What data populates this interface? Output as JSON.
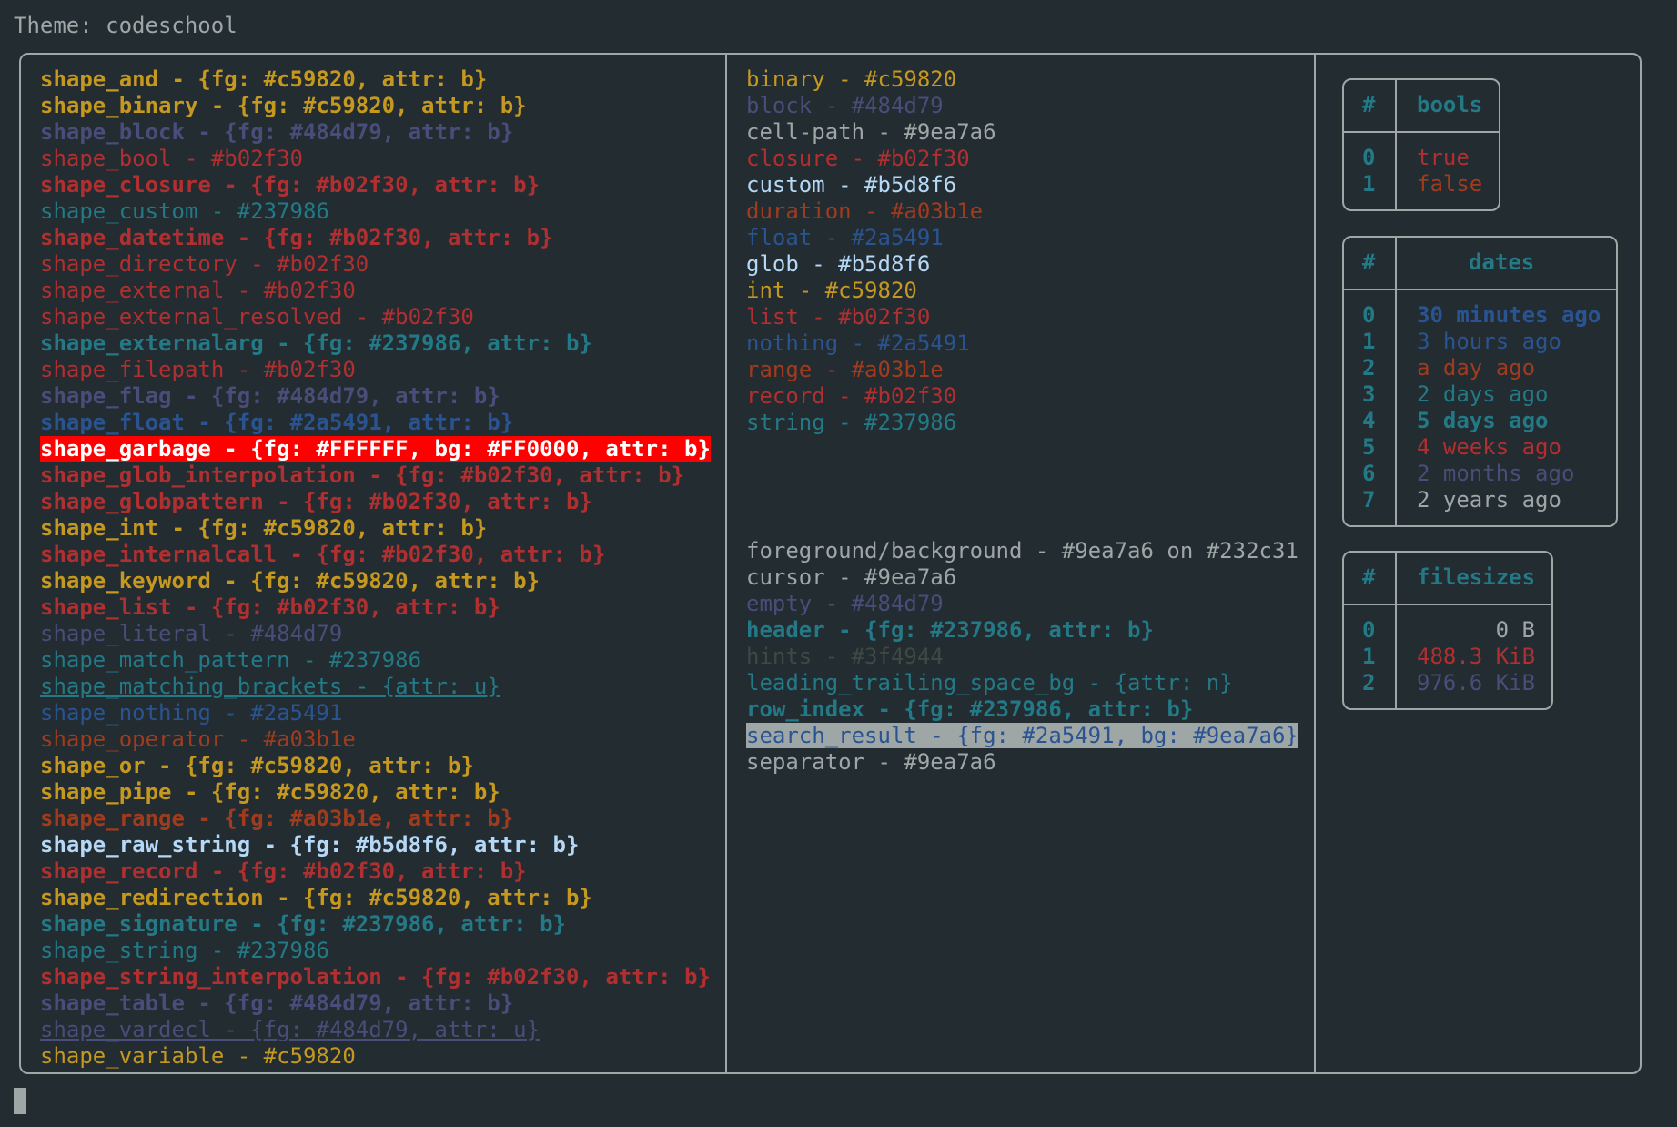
{
  "header": {
    "title": "Theme: codeschool"
  },
  "colors": {
    "background": "#232c31",
    "foreground": "#9ea7a6",
    "yellow": "#c59820",
    "purple": "#484d79",
    "red": "#b02f30",
    "teal": "#237986",
    "blue": "#2a5491",
    "orange": "#a03b1e",
    "light": "#b5d8f6",
    "hint": "#3f4944"
  },
  "shapes": [
    {
      "text": "shape_and - {fg: #c59820, attr: b}",
      "fg": "#c59820",
      "bold": true
    },
    {
      "text": "shape_binary - {fg: #c59820, attr: b}",
      "fg": "#c59820",
      "bold": true
    },
    {
      "text": "shape_block - {fg: #484d79, attr: b}",
      "fg": "#484d79",
      "bold": true
    },
    {
      "text": "shape_bool - #b02f30",
      "fg": "#b02f30"
    },
    {
      "text": "shape_closure - {fg: #b02f30, attr: b}",
      "fg": "#b02f30",
      "bold": true
    },
    {
      "text": "shape_custom - #237986",
      "fg": "#237986"
    },
    {
      "text": "shape_datetime - {fg: #b02f30, attr: b}",
      "fg": "#b02f30",
      "bold": true
    },
    {
      "text": "shape_directory - #b02f30",
      "fg": "#b02f30"
    },
    {
      "text": "shape_external - #b02f30",
      "fg": "#b02f30"
    },
    {
      "text": "shape_external_resolved - #b02f30",
      "fg": "#b02f30"
    },
    {
      "text": "shape_externalarg - {fg: #237986, attr: b}",
      "fg": "#237986",
      "bold": true
    },
    {
      "text": "shape_filepath - #b02f30",
      "fg": "#b02f30"
    },
    {
      "text": "shape_flag - {fg: #484d79, attr: b}",
      "fg": "#484d79",
      "bold": true
    },
    {
      "text": "shape_float - {fg: #2a5491, attr: b}",
      "fg": "#2a5491",
      "bold": true
    },
    {
      "text": "shape_garbage - {fg: #FFFFFF, bg: #FF0000, attr: b}",
      "fg": "#FFFFFF",
      "bg": "#FF0000",
      "bold": true
    },
    {
      "text": "shape_glob_interpolation - {fg: #b02f30, attr: b}",
      "fg": "#b02f30",
      "bold": true
    },
    {
      "text": "shape_globpattern - {fg: #b02f30, attr: b}",
      "fg": "#b02f30",
      "bold": true
    },
    {
      "text": "shape_int - {fg: #c59820, attr: b}",
      "fg": "#c59820",
      "bold": true
    },
    {
      "text": "shape_internalcall - {fg: #b02f30, attr: b}",
      "fg": "#b02f30",
      "bold": true
    },
    {
      "text": "shape_keyword - {fg: #c59820, attr: b}",
      "fg": "#c59820",
      "bold": true
    },
    {
      "text": "shape_list - {fg: #b02f30, attr: b}",
      "fg": "#b02f30",
      "bold": true
    },
    {
      "text": "shape_literal - #484d79",
      "fg": "#484d79"
    },
    {
      "text": "shape_match_pattern - #237986",
      "fg": "#237986"
    },
    {
      "text": "shape_matching_brackets - {attr: u}",
      "fg": "#237986",
      "underline": true
    },
    {
      "text": "shape_nothing - #2a5491",
      "fg": "#2a5491"
    },
    {
      "text": "shape_operator - #a03b1e",
      "fg": "#a03b1e"
    },
    {
      "text": "shape_or - {fg: #c59820, attr: b}",
      "fg": "#c59820",
      "bold": true
    },
    {
      "text": "shape_pipe - {fg: #c59820, attr: b}",
      "fg": "#c59820",
      "bold": true
    },
    {
      "text": "shape_range - {fg: #a03b1e, attr: b}",
      "fg": "#a03b1e",
      "bold": true
    },
    {
      "text": "shape_raw_string - {fg: #b5d8f6, attr: b}",
      "fg": "#b5d8f6",
      "bold": true
    },
    {
      "text": "shape_record - {fg: #b02f30, attr: b}",
      "fg": "#b02f30",
      "bold": true
    },
    {
      "text": "shape_redirection - {fg: #c59820, attr: b}",
      "fg": "#c59820",
      "bold": true
    },
    {
      "text": "shape_signature - {fg: #237986, attr: b}",
      "fg": "#237986",
      "bold": true
    },
    {
      "text": "shape_string - #237986",
      "fg": "#237986"
    },
    {
      "text": "shape_string_interpolation - {fg: #b02f30, attr: b}",
      "fg": "#b02f30",
      "bold": true
    },
    {
      "text": "shape_table - {fg: #484d79, attr: b}",
      "fg": "#484d79",
      "bold": true
    },
    {
      "text": "shape_vardecl - {fg: #484d79, attr: u}",
      "fg": "#484d79",
      "underline": true
    },
    {
      "text": "shape_variable - #c59820",
      "fg": "#c59820"
    }
  ],
  "types": [
    {
      "text": "binary - #c59820",
      "fg": "#c59820"
    },
    {
      "text": "block - #484d79",
      "fg": "#484d79"
    },
    {
      "text": "cell-path - #9ea7a6",
      "fg": "#9ea7a6"
    },
    {
      "text": "closure - #b02f30",
      "fg": "#b02f30"
    },
    {
      "text": "custom - #b5d8f6",
      "fg": "#b5d8f6"
    },
    {
      "text": "duration - #a03b1e",
      "fg": "#a03b1e"
    },
    {
      "text": "float - #2a5491",
      "fg": "#2a5491"
    },
    {
      "text": "glob - #b5d8f6",
      "fg": "#b5d8f6"
    },
    {
      "text": "int - #c59820",
      "fg": "#c59820"
    },
    {
      "text": "list - #b02f30",
      "fg": "#b02f30"
    },
    {
      "text": "nothing - #2a5491",
      "fg": "#2a5491"
    },
    {
      "text": "range - #a03b1e",
      "fg": "#a03b1e"
    },
    {
      "text": "record - #b02f30",
      "fg": "#b02f30"
    },
    {
      "text": "string - #237986",
      "fg": "#237986"
    }
  ],
  "ui": [
    {
      "text": "foreground/background - #9ea7a6 on #232c31",
      "fg": "#9ea7a6"
    },
    {
      "text": "cursor - #9ea7a6",
      "fg": "#9ea7a6"
    },
    {
      "text": "empty - #484d79",
      "fg": "#484d79"
    },
    {
      "text": "header - {fg: #237986, attr: b}",
      "fg": "#237986",
      "bold": true
    },
    {
      "text": "hints - #3f4944",
      "fg": "#3f4944"
    },
    {
      "text": "leading_trailing_space_bg - {attr: n}",
      "fg": "#237986"
    },
    {
      "text": "row_index - {fg: #237986, attr: b}",
      "fg": "#237986",
      "bold": true
    },
    {
      "text": "search_result - {fg: #2a5491, bg: #9ea7a6}",
      "fg": "#2a5491",
      "bg": "#9ea7a6"
    },
    {
      "text": "separator - #9ea7a6",
      "fg": "#9ea7a6"
    }
  ],
  "tables": {
    "bools": {
      "index_header": "#",
      "header": "bools",
      "rows": [
        {
          "index": "0",
          "value": "true",
          "fg": "#b02f30"
        },
        {
          "index": "1",
          "value": "false",
          "fg": "#a03b1e"
        }
      ]
    },
    "dates": {
      "index_header": "#",
      "header": "dates",
      "rows": [
        {
          "index": "0",
          "value": "30 minutes ago",
          "fg": "#2a5491",
          "bold": true
        },
        {
          "index": "1",
          "value": "3 hours ago",
          "fg": "#2a5491"
        },
        {
          "index": "2",
          "value": "a day ago",
          "fg": "#a03b1e"
        },
        {
          "index": "3",
          "value": "2 days ago",
          "fg": "#237986"
        },
        {
          "index": "4",
          "value": "5 days ago",
          "fg": "#237986",
          "bold": true
        },
        {
          "index": "5",
          "value": "4 weeks ago",
          "fg": "#b02f30"
        },
        {
          "index": "6",
          "value": "2 months ago",
          "fg": "#484d79"
        },
        {
          "index": "7",
          "value": "2 years ago",
          "fg": "#9ea7a6"
        }
      ]
    },
    "filesizes": {
      "index_header": "#",
      "header": "filesizes",
      "rows": [
        {
          "index": "0",
          "value": "0 B",
          "fg": "#9ea7a6"
        },
        {
          "index": "1",
          "value": "488.3 KiB",
          "fg": "#b02f30"
        },
        {
          "index": "2",
          "value": "976.6 KiB",
          "fg": "#484d79"
        }
      ]
    }
  }
}
